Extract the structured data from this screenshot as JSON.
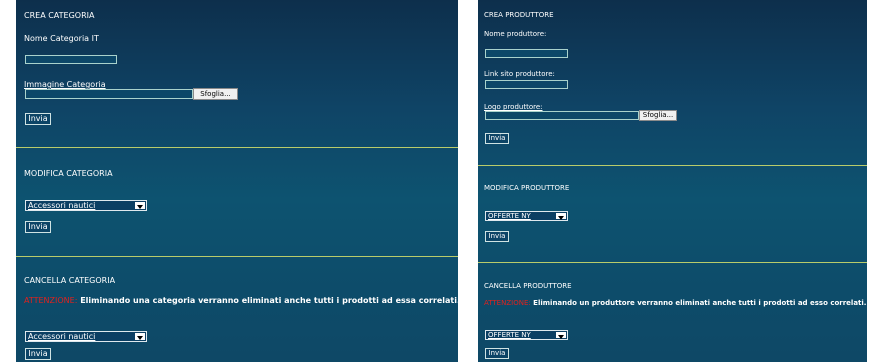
{
  "left": {
    "create": {
      "title": "CREA CATEGORIA",
      "name_label": "Nome Categoria IT",
      "name_value": "",
      "image_label": "Immagine Categoria",
      "image_value": "",
      "browse_label": "Sfoglia...",
      "submit_label": "Invia"
    },
    "edit": {
      "title": "MODIFICA CATEGORIA",
      "selected": "Accessori nautici",
      "submit_label": "Invia"
    },
    "delete": {
      "title": "CANCELLA CATEGORIA",
      "warning_prefix": "ATTENZIONE:",
      "warning_text": "Eliminando una categoria verranno eliminati anche tutti i prodotti ad essa correlati.",
      "selected": "Accessori nautici",
      "submit_label": "Invia"
    }
  },
  "right": {
    "create": {
      "title": "CREA PRODUTTORE",
      "name_label": "Nome produttore:",
      "name_value": "",
      "link_label": "Link sito produttore:",
      "link_value": "",
      "logo_label": "Logo produttore:",
      "logo_value": "",
      "browse_label": "Sfoglia...",
      "submit_label": "Invia"
    },
    "edit": {
      "title": "MODIFICA PRODUTTORE",
      "selected": "OFFERTE NY",
      "submit_label": "Invia"
    },
    "delete": {
      "title": "CANCELLA PRODUTTORE",
      "warning_prefix": "ATTENZIONE:",
      "warning_text": "Eliminando un produttore verranno eliminati anche tutti i prodotti ad esso correlati.",
      "selected": "OFFERTE NY",
      "submit_label": "Invia"
    }
  },
  "colors": {
    "panel_top": "#0d2f4c",
    "panel_mid": "#0d5370",
    "divider": "#b8cc6a",
    "warning_red": "#e0221e"
  }
}
